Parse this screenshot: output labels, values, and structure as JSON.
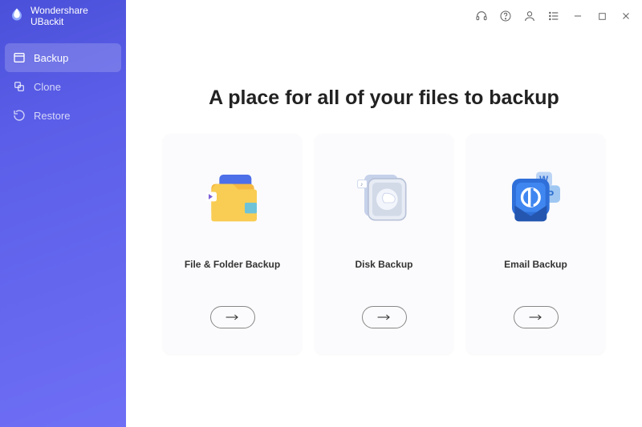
{
  "brand": {
    "title": "Wondershare UBackit"
  },
  "sidebar": {
    "items": [
      {
        "label": "Backup",
        "active": true
      },
      {
        "label": "Clone",
        "active": false
      },
      {
        "label": "Restore",
        "active": false
      }
    ]
  },
  "main": {
    "heading": "A place for all of your files to backup",
    "cards": [
      {
        "title": "File & Folder Backup"
      },
      {
        "title": "Disk Backup"
      },
      {
        "title": "Email Backup"
      }
    ]
  }
}
